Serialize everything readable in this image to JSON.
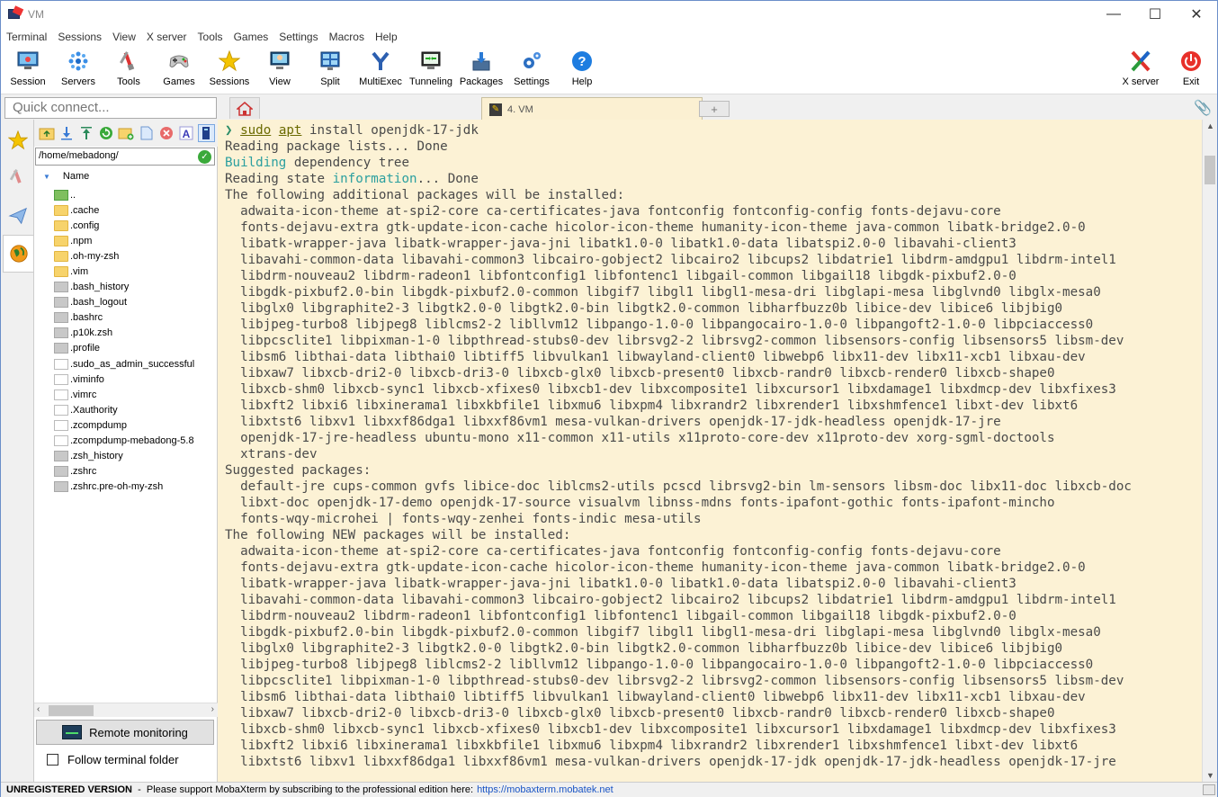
{
  "window": {
    "title": "VM",
    "minimize": "—",
    "maximize": "☐",
    "close": "✕"
  },
  "menu": [
    "Terminal",
    "Sessions",
    "View",
    "X server",
    "Tools",
    "Games",
    "Settings",
    "Macros",
    "Help"
  ],
  "toolbar": {
    "session": "Session",
    "servers": "Servers",
    "tools": "Tools",
    "games": "Games",
    "sessions": "Sessions",
    "view": "View",
    "split": "Split",
    "multiexec": "MultiExec",
    "tunneling": "Tunneling",
    "packages": "Packages",
    "settings": "Settings",
    "help": "Help",
    "xserver": "X server",
    "exit": "Exit"
  },
  "quick_connect": {
    "placeholder": "Quick connect..."
  },
  "tabs": {
    "active_label": "4. VM",
    "add": "+"
  },
  "sftp": {
    "path": "/home/mebadong/",
    "column_name": "Name",
    "files": [
      {
        "name": "..",
        "type": "up"
      },
      {
        "name": ".cache",
        "type": "folder"
      },
      {
        "name": ".config",
        "type": "folder"
      },
      {
        "name": ".npm",
        "type": "folder"
      },
      {
        "name": ".oh-my-zsh",
        "type": "folder"
      },
      {
        "name": ".vim",
        "type": "folder"
      },
      {
        "name": ".bash_history",
        "type": "file"
      },
      {
        "name": ".bash_logout",
        "type": "file"
      },
      {
        "name": ".bashrc",
        "type": "file"
      },
      {
        "name": ".p10k.zsh",
        "type": "file"
      },
      {
        "name": ".profile",
        "type": "file"
      },
      {
        "name": ".sudo_as_admin_successful",
        "type": "doc"
      },
      {
        "name": ".viminfo",
        "type": "doc"
      },
      {
        "name": ".vimrc",
        "type": "doc"
      },
      {
        "name": ".Xauthority",
        "type": "doc"
      },
      {
        "name": ".zcompdump",
        "type": "doc"
      },
      {
        "name": ".zcompdump-mebadong-5.8",
        "type": "doc"
      },
      {
        "name": ".zsh_history",
        "type": "file"
      },
      {
        "name": ".zshrc",
        "type": "file"
      },
      {
        "name": ".zshrc.pre-oh-my-zsh",
        "type": "file"
      }
    ],
    "remote_monitoring": "Remote monitoring",
    "follow_folder": "Follow terminal folder"
  },
  "terminal": {
    "prompt_symbol": "❯",
    "cmd_sudo": "sudo",
    "cmd_apt": "apt",
    "cmd_rest": " install openjdk-17-jdk",
    "line_reading": "Reading package lists... Done",
    "building": "Building",
    "building_rest": " dependency tree",
    "state_a": "Reading state ",
    "state_info": "information",
    "state_b": "... Done",
    "lines": [
      "The following additional packages will be installed:",
      "  adwaita-icon-theme at-spi2-core ca-certificates-java fontconfig fontconfig-config fonts-dejavu-core",
      "  fonts-dejavu-extra gtk-update-icon-cache hicolor-icon-theme humanity-icon-theme java-common libatk-bridge2.0-0",
      "  libatk-wrapper-java libatk-wrapper-java-jni libatk1.0-0 libatk1.0-data libatspi2.0-0 libavahi-client3",
      "  libavahi-common-data libavahi-common3 libcairo-gobject2 libcairo2 libcups2 libdatrie1 libdrm-amdgpu1 libdrm-intel1",
      "  libdrm-nouveau2 libdrm-radeon1 libfontconfig1 libfontenc1 libgail-common libgail18 libgdk-pixbuf2.0-0",
      "  libgdk-pixbuf2.0-bin libgdk-pixbuf2.0-common libgif7 libgl1 libgl1-mesa-dri libglapi-mesa libglvnd0 libglx-mesa0",
      "  libglx0 libgraphite2-3 libgtk2.0-0 libgtk2.0-bin libgtk2.0-common libharfbuzz0b libice-dev libice6 libjbig0",
      "  libjpeg-turbo8 libjpeg8 liblcms2-2 libllvm12 libpango-1.0-0 libpangocairo-1.0-0 libpangoft2-1.0-0 libpciaccess0",
      "  libpcsclite1 libpixman-1-0 libpthread-stubs0-dev librsvg2-2 librsvg2-common libsensors-config libsensors5 libsm-dev",
      "  libsm6 libthai-data libthai0 libtiff5 libvulkan1 libwayland-client0 libwebp6 libx11-dev libx11-xcb1 libxau-dev",
      "  libxaw7 libxcb-dri2-0 libxcb-dri3-0 libxcb-glx0 libxcb-present0 libxcb-randr0 libxcb-render0 libxcb-shape0",
      "  libxcb-shm0 libxcb-sync1 libxcb-xfixes0 libxcb1-dev libxcomposite1 libxcursor1 libxdamage1 libxdmcp-dev libxfixes3",
      "  libxft2 libxi6 libxinerama1 libxkbfile1 libxmu6 libxpm4 libxrandr2 libxrender1 libxshmfence1 libxt-dev libxt6",
      "  libxtst6 libxv1 libxxf86dga1 libxxf86vm1 mesa-vulkan-drivers openjdk-17-jdk-headless openjdk-17-jre",
      "  openjdk-17-jre-headless ubuntu-mono x11-common x11-utils x11proto-core-dev x11proto-dev xorg-sgml-doctools",
      "  xtrans-dev",
      "Suggested packages:",
      "  default-jre cups-common gvfs libice-doc liblcms2-utils pcscd librsvg2-bin lm-sensors libsm-doc libx11-doc libxcb-doc",
      "  libxt-doc openjdk-17-demo openjdk-17-source visualvm libnss-mdns fonts-ipafont-gothic fonts-ipafont-mincho",
      "  fonts-wqy-microhei | fonts-wqy-zenhei fonts-indic mesa-utils",
      "The following NEW packages will be installed:",
      "  adwaita-icon-theme at-spi2-core ca-certificates-java fontconfig fontconfig-config fonts-dejavu-core",
      "  fonts-dejavu-extra gtk-update-icon-cache hicolor-icon-theme humanity-icon-theme java-common libatk-bridge2.0-0",
      "  libatk-wrapper-java libatk-wrapper-java-jni libatk1.0-0 libatk1.0-data libatspi2.0-0 libavahi-client3",
      "  libavahi-common-data libavahi-common3 libcairo-gobject2 libcairo2 libcups2 libdatrie1 libdrm-amdgpu1 libdrm-intel1",
      "  libdrm-nouveau2 libdrm-radeon1 libfontconfig1 libfontenc1 libgail-common libgail18 libgdk-pixbuf2.0-0",
      "  libgdk-pixbuf2.0-bin libgdk-pixbuf2.0-common libgif7 libgl1 libgl1-mesa-dri libglapi-mesa libglvnd0 libglx-mesa0",
      "  libglx0 libgraphite2-3 libgtk2.0-0 libgtk2.0-bin libgtk2.0-common libharfbuzz0b libice-dev libice6 libjbig0",
      "  libjpeg-turbo8 libjpeg8 liblcms2-2 libllvm12 libpango-1.0-0 libpangocairo-1.0-0 libpangoft2-1.0-0 libpciaccess0",
      "  libpcsclite1 libpixman-1-0 libpthread-stubs0-dev librsvg2-2 librsvg2-common libsensors-config libsensors5 libsm-dev",
      "  libsm6 libthai-data libthai0 libtiff5 libvulkan1 libwayland-client0 libwebp6 libx11-dev libx11-xcb1 libxau-dev",
      "  libxaw7 libxcb-dri2-0 libxcb-dri3-0 libxcb-glx0 libxcb-present0 libxcb-randr0 libxcb-render0 libxcb-shape0",
      "  libxcb-shm0 libxcb-sync1 libxcb-xfixes0 libxcb1-dev libxcomposite1 libxcursor1 libxdamage1 libxdmcp-dev libxfixes3",
      "  libxft2 libxi6 libxinerama1 libxkbfile1 libxmu6 libxpm4 libxrandr2 libxrender1 libxshmfence1 libxt-dev libxt6",
      "  libxtst6 libxv1 libxxf86dga1 libxxf86vm1 mesa-vulkan-drivers openjdk-17-jdk openjdk-17-jdk-headless openjdk-17-jre"
    ]
  },
  "status": {
    "unregistered": "UNREGISTERED VERSION",
    "message": "  -  Please support MobaXterm by subscribing to the professional edition here:",
    "link": "https://mobaxterm.mobatek.net"
  }
}
